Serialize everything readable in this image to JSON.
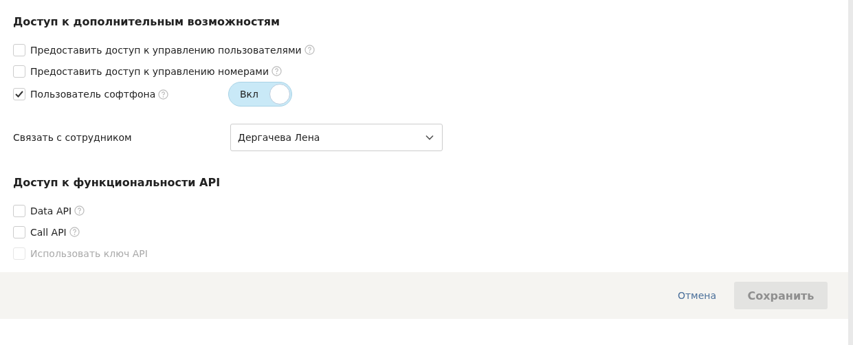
{
  "sections": [
    {
      "title": "Доступ к дополнительным возможностям",
      "options": [
        {
          "label": "Предоставить доступ к управлению пользователями",
          "checked": false,
          "disabled": false,
          "help": true
        },
        {
          "label": "Предоставить доступ к управлению номерами",
          "checked": false,
          "disabled": false,
          "help": true
        },
        {
          "label": "Пользователь софтфона",
          "checked": true,
          "disabled": false,
          "help": true,
          "toggle": {
            "label": "Вкл",
            "on": true
          }
        }
      ],
      "link": {
        "label": "Связать с сотрудником",
        "value": "Дергачева Лена"
      }
    },
    {
      "title": "Доступ к функциональности API",
      "options": [
        {
          "label": "Data API",
          "checked": false,
          "disabled": false,
          "help": true
        },
        {
          "label": "Call API",
          "checked": false,
          "disabled": false,
          "help": true
        },
        {
          "label": "Использовать ключ API",
          "checked": false,
          "disabled": true,
          "help": false
        }
      ]
    }
  ],
  "footer": {
    "cancel": "Отмена",
    "save": {
      "label": "Сохранить",
      "disabled": true
    }
  }
}
